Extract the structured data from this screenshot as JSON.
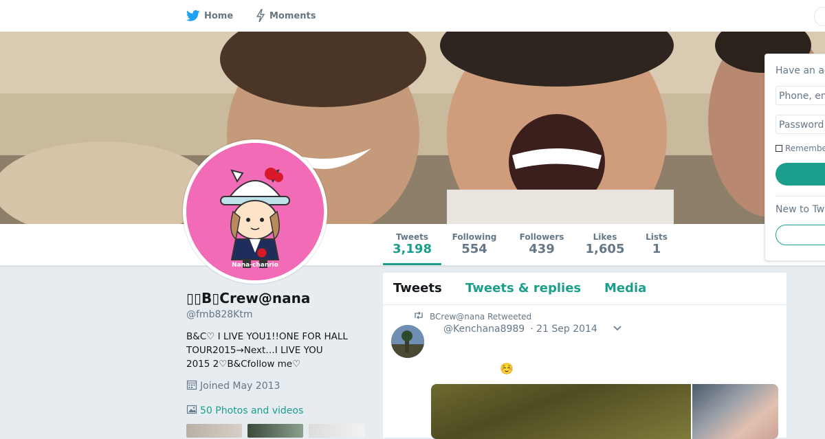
{
  "nav": {
    "home_label": "Home",
    "moments_label": "Moments",
    "home_icon": "twitter-bird-icon",
    "moments_icon": "lightning-icon",
    "accent_color": "#1da1f2"
  },
  "stats": [
    {
      "label": "Tweets",
      "value": "3,198",
      "active": true
    },
    {
      "label": "Following",
      "value": "554"
    },
    {
      "label": "Followers",
      "value": "439"
    },
    {
      "label": "Likes",
      "value": "1,605"
    },
    {
      "label": "Lists",
      "value": "1"
    }
  ],
  "avatar": {
    "caption": "Nana-chanrio"
  },
  "profile": {
    "name": "▯▯B▯Crew@nana",
    "handle": "@fmb828Ktm",
    "bio_line1": "B&C♡ I LIVE YOU1!!ONE FOR HALL",
    "bio_line2": "TOUR2015→Next…I LIVE YOU",
    "bio_line3": "2015 2♡B&Cfollow me♡",
    "joined": "Joined May 2013",
    "photos_link": "50 Photos and videos"
  },
  "timeline": {
    "tabs": [
      {
        "label": "Tweets",
        "active": true
      },
      {
        "label": "Tweets & replies"
      },
      {
        "label": "Media"
      }
    ],
    "tweet": {
      "retweet_text": "BCrew@nana Retweeted",
      "handle": "@Kenchana8989",
      "date": "· 21 Sep 2014",
      "emoji": "☺️"
    }
  },
  "login": {
    "title": "Have an account?",
    "phone_placeholder": "Phone, email or username",
    "password_placeholder": "Password",
    "remember_label": "Remember me",
    "new_label": "New to Twitter?"
  },
  "colors": {
    "teal_accent": "#1b9e8c",
    "avatar_pink": "#f26bb7"
  }
}
